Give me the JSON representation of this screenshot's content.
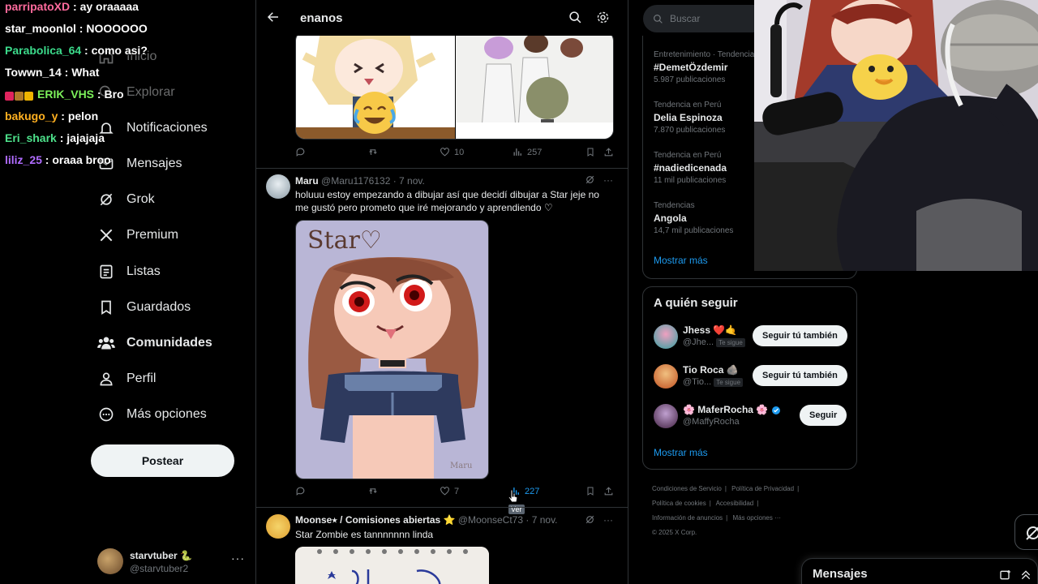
{
  "chat": [
    {
      "user": "parripatoXD",
      "color": "#ff6b9d",
      "msg": "ay oraaaaa",
      "badges": []
    },
    {
      "user": "star_moonlol",
      "color": "#ffffff",
      "msg": "NOOOOOO",
      "badges": []
    },
    {
      "user": "Parabolica_64",
      "color": "#3cdc8c",
      "msg": "como asi?",
      "badges": []
    },
    {
      "user": "Towwn_14",
      "color": "#ffffff",
      "msg": "What",
      "badges": []
    },
    {
      "user": "ERIK_VHS",
      "color": "#7cf05a",
      "msg": "Bro",
      "badges": [
        "#e0245e",
        "#b07a2a",
        "#f0b400"
      ]
    },
    {
      "user": "bakugo_y",
      "color": "#ffb020",
      "msg": "pelon",
      "badges": []
    },
    {
      "user": "Eri_shark",
      "color": "#4de08a",
      "msg": "jajajaja",
      "badges": []
    },
    {
      "user": "liliz_25",
      "color": "#b06cff",
      "msg": "oraaa broo",
      "badges": []
    }
  ],
  "sidebar": {
    "items": [
      {
        "label": "Inicio",
        "icon": "home-icon"
      },
      {
        "label": "Explorar",
        "icon": "search-icon"
      },
      {
        "label": "Notificaciones",
        "icon": "bell-icon"
      },
      {
        "label": "Mensajes",
        "icon": "mail-icon"
      },
      {
        "label": "Grok",
        "icon": "grok-icon"
      },
      {
        "label": "Premium",
        "icon": "x-logo-icon"
      },
      {
        "label": "Listas",
        "icon": "list-icon"
      },
      {
        "label": "Guardados",
        "icon": "bookmark-icon"
      },
      {
        "label": "Comunidades",
        "icon": "communities-icon"
      },
      {
        "label": "Perfil",
        "icon": "person-icon"
      },
      {
        "label": "Más opciones",
        "icon": "more-circle-icon"
      }
    ],
    "post_label": "Postear",
    "profile": {
      "name": "starvtuber 🐍",
      "handle": "@starvtuber2"
    }
  },
  "timeline": {
    "query": "enanos",
    "tweet1": {
      "likes": "10",
      "views": "257"
    },
    "tweet2": {
      "name": "Maru",
      "handle": "@Maru1176132",
      "date": "· 7 nov.",
      "text": "holuuu estoy empezando a dibujar así que decidí dibujar a Star jeje no me gustó pero prometo que iré mejorando y aprendiendo ♡",
      "drawing_caption": "Star♡",
      "likes": "7",
      "views": "227",
      "tooltip": "Ver"
    },
    "tweet3": {
      "name": "Moonse⭑ / Comisiones abiertas ⭐",
      "handle": "@MoonseCt73",
      "date": "· 7 nov.",
      "text": "Star Zombie es tannnnnnn linda"
    }
  },
  "right": {
    "search_placeholder": "Buscar",
    "trends": [
      {
        "context": "Entretenimiento · Tendencia",
        "title": "#DemetÖzdemir",
        "count": "5.987 publicaciones"
      },
      {
        "context": "Tendencia en Perú",
        "title": "Delia Espinoza",
        "count": "7.870 publicaciones"
      },
      {
        "context": "Tendencia en Perú",
        "title": "#nadiedicenada",
        "count": "11 mil publicaciones"
      },
      {
        "context": "Tendencias",
        "title": "Angola",
        "count": "14,7 mil publicaciones"
      }
    ],
    "show_more": "Mostrar más",
    "who_title": "A quién seguir",
    "who": [
      {
        "name": "Jhess ❤️🤙",
        "handle": "@Jhe...",
        "tag": "Te sigue",
        "button": "Seguir tú también"
      },
      {
        "name": "Tio Roca 🪨",
        "handle": "@Tio...",
        "tag": "Te sigue",
        "button": "Seguir tú también"
      },
      {
        "name": "🌸 MaferRocha 🌸",
        "handle": "@MaffyRocha",
        "tag": "",
        "button": "Seguir"
      }
    ],
    "who_more": "Mostrar más",
    "footer": {
      "l1": "Condiciones de Servicio",
      "l2": "Política de Privacidad",
      "l3": "Política de cookies",
      "l4": "Accesibilidad",
      "l5": "Información de anuncios",
      "l6": "Más opciones ···",
      "l7": "© 2025 X Corp."
    },
    "messages_title": "Mensajes"
  },
  "colors": {
    "accent": "#1d9bf0",
    "border": "#2f3336",
    "muted": "#71767b"
  }
}
